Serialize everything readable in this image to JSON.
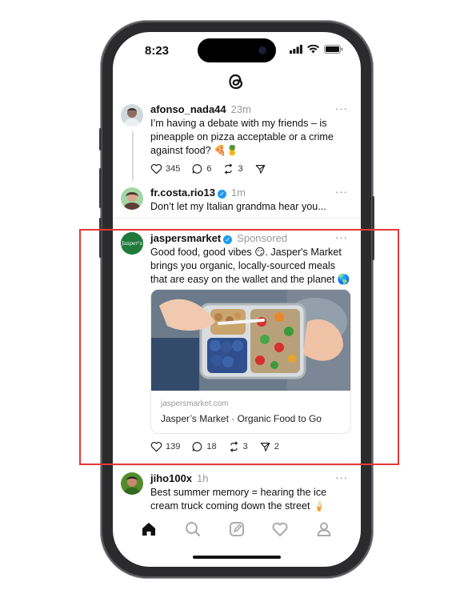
{
  "status_bar": {
    "time": "8:23"
  },
  "feed": {
    "posts": [
      {
        "username": "afonso_nada44",
        "time": "23m",
        "text": "I’m having a debate with my friends – is pineapple on pizza acceptable or a crime against food? 🍕🍍",
        "likes": "345",
        "replies": "6",
        "reposts": "3"
      },
      {
        "username": "fr.costa.rio13",
        "time": "1m",
        "text": "Don’t let my Italian grandma hear you..."
      },
      {
        "username": "jaspersmarket",
        "label": "Sponsored",
        "text": "Good food, good vibes 😏. Jasper's Market brings you organic, locally-sourced meals that are easy on the wallet and the planet 🌎",
        "link_domain": "jaspersmarket.com",
        "link_title": "Jasper’s Market · Organic Food to Go",
        "likes": "139",
        "replies": "18",
        "reposts": "3",
        "shares": "2",
        "avatar_text": "Jasper's"
      },
      {
        "username": "jiho100x",
        "time": "1h",
        "text": "Best summer memory = hearing the ice cream truck coming down the street 🍦"
      }
    ]
  },
  "more_icon": "···",
  "colors": {
    "accent": "#1d9bf0",
    "highlight": "#e53935",
    "brand_green": "#1f7a3a"
  },
  "icons": [
    "threads-logo-icon",
    "heart-icon",
    "comment-icon",
    "repost-icon",
    "share-icon",
    "home-icon",
    "search-icon",
    "compose-icon",
    "activity-heart-icon",
    "profile-icon"
  ]
}
